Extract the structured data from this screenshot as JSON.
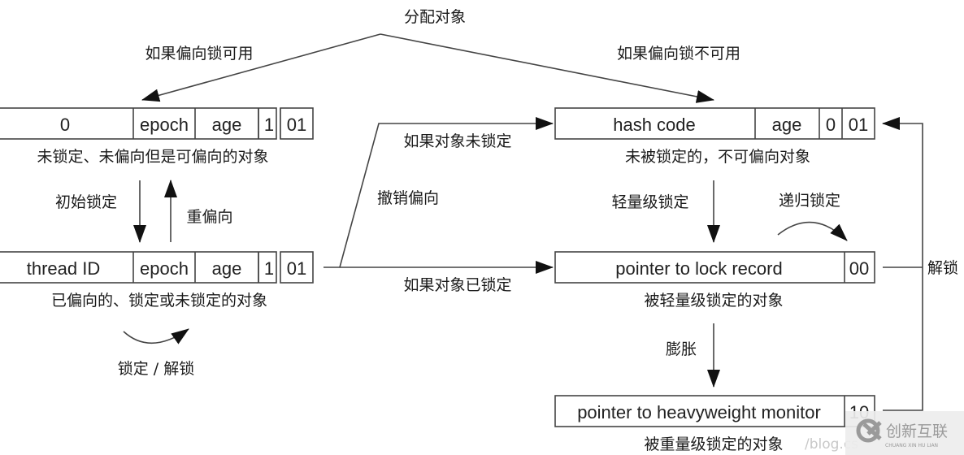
{
  "title": "分配对象",
  "branches": {
    "biased_available": "如果偏向锁可用",
    "biased_unavailable": "如果偏向锁不可用"
  },
  "states": {
    "unlocked_biasable": {
      "fields": [
        "0",
        "epoch",
        "age",
        "1",
        "01"
      ],
      "caption": "未锁定、未偏向但是可偏向的对象"
    },
    "biased": {
      "fields": [
        "thread ID",
        "epoch",
        "age",
        "1",
        "01"
      ],
      "caption": "已偏向的、锁定或未锁定的对象"
    },
    "unlocked_unbiasable": {
      "fields": [
        "hash code",
        "age",
        "0",
        "01"
      ],
      "caption": "未被锁定的，不可偏向对象"
    },
    "lightweight": {
      "fields": [
        "pointer to lock record",
        "00"
      ],
      "caption": "被轻量级锁定的对象"
    },
    "heavyweight": {
      "fields": [
        "pointer to heavyweight monitor",
        "10"
      ],
      "caption": "被重量级锁定的对象"
    }
  },
  "transitions": {
    "initial_lock": "初始锁定",
    "rebias": "重偏向",
    "lock_unlock": "锁定 / 解锁",
    "revoke_bias": "撤销偏向",
    "if_unlocked": "如果对象未锁定",
    "if_locked": "如果对象已锁定",
    "lightweight_lock": "轻量级锁定",
    "recursive_lock": "递归锁定",
    "inflate": "膨胀",
    "unlock": "解锁"
  },
  "watermark": {
    "url_fragment": "/blog.cs",
    "brand": "创新互联",
    "brand_sub": "CHUANG XIN HU LIAN"
  }
}
